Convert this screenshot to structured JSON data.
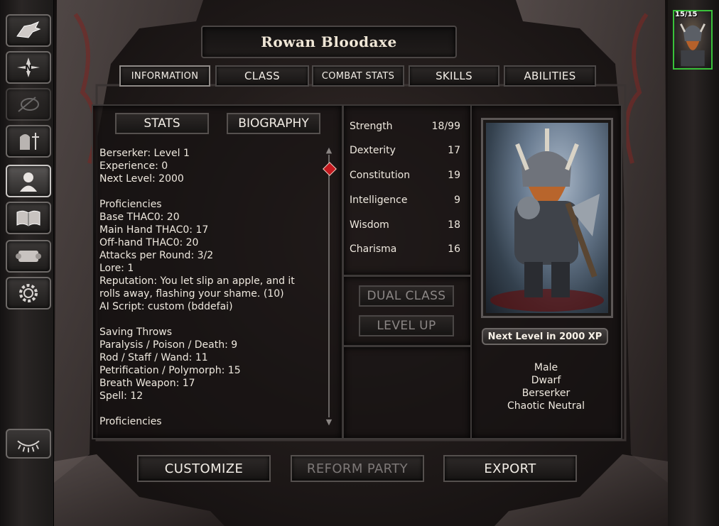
{
  "character": {
    "name": "Rowan Bloodaxe",
    "hp": "15/15"
  },
  "tabs": [
    {
      "label": "INFORMATION"
    },
    {
      "label": "CLASS"
    },
    {
      "label": "COMBAT STATS"
    },
    {
      "label": "SKILLS"
    },
    {
      "label": "ABILITIES"
    }
  ],
  "subtabs": [
    {
      "label": "STATS"
    },
    {
      "label": "BIOGRAPHY"
    }
  ],
  "stats_text": {
    "class_level": "Berserker: Level 1",
    "experience": "Experience: 0",
    "next_level": "Next Level: 2000",
    "proficiencies_heading": "Proficiencies",
    "base_thac0": "Base THAC0: 20",
    "main_hand_thac0": "Main Hand THAC0: 17",
    "off_hand_thac0": "Off-hand THAC0: 20",
    "attacks": "Attacks per Round: 3/2",
    "lore": "Lore: 1",
    "reputation": "Reputation: You let slip an apple, and it rolls away, flashing your shame. (10)",
    "ai_script": "AI Script: custom (bddefai)",
    "saving_throws_heading": "Saving Throws",
    "save_paralysis": "Paralysis / Poison / Death: 9",
    "save_rod": "Rod / Staff / Wand: 11",
    "save_petrification": "Petrification / Polymorph: 15",
    "save_breath": "Breath Weapon: 17",
    "save_spell": "Spell: 12",
    "proficiencies_heading_2": "Proficiencies"
  },
  "attributes": [
    {
      "name": "Strength",
      "value": "18/99"
    },
    {
      "name": "Dexterity",
      "value": "17"
    },
    {
      "name": "Constitution",
      "value": "19"
    },
    {
      "name": "Intelligence",
      "value": "9"
    },
    {
      "name": "Wisdom",
      "value": "18"
    },
    {
      "name": "Charisma",
      "value": "16"
    }
  ],
  "class_buttons": {
    "dual_class": "DUAL CLASS",
    "level_up": "LEVEL UP"
  },
  "xp_plate": "Next Level in 2000 XP",
  "bio": {
    "gender": "Male",
    "race": "Dwarf",
    "class": "Berserker",
    "alignment": "Chaotic Neutral"
  },
  "bottom_buttons": {
    "customize": "CUSTOMIZE",
    "reform_party": "REFORM PARTY",
    "export": "EXPORT"
  },
  "sidebar": {
    "items": [
      {
        "icon": "dragon-head-icon",
        "active": false
      },
      {
        "icon": "compass-map-icon",
        "active": false
      },
      {
        "icon": "journal-quill-icon",
        "active": false
      },
      {
        "icon": "inventory-icon",
        "active": false
      },
      {
        "icon": "character-record-icon",
        "active": true
      },
      {
        "icon": "mage-book-icon",
        "active": false
      },
      {
        "icon": "priest-scroll-icon",
        "active": false
      },
      {
        "icon": "options-gear-icon",
        "active": false
      }
    ],
    "rest": {
      "icon": "rest-eye-icon"
    }
  },
  "colors": {
    "party_portrait_border": "#39c23a",
    "scroll_thumb": "#c4181e"
  }
}
